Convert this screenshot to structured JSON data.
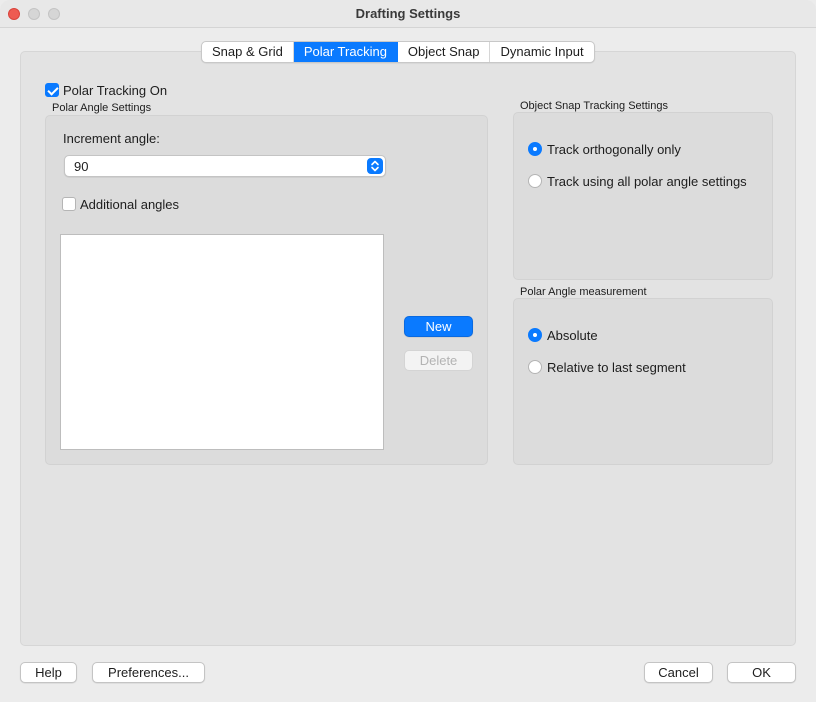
{
  "window": {
    "title": "Drafting Settings"
  },
  "tabs": [
    {
      "label": "Snap & Grid",
      "active": false
    },
    {
      "label": "Polar Tracking",
      "active": true
    },
    {
      "label": "Object Snap",
      "active": false
    },
    {
      "label": "Dynamic Input",
      "active": false
    }
  ],
  "polar": {
    "enable_label": "Polar Tracking On",
    "enabled": true,
    "group_title": "Polar Angle Settings",
    "increment_label": "Increment angle:",
    "increment_value": "90",
    "additional_label": "Additional angles",
    "additional_checked": false,
    "additional_list": [],
    "new_label": "New",
    "delete_label": "Delete"
  },
  "snap_tracking": {
    "group_title": "Object Snap Tracking Settings",
    "options": [
      {
        "label": "Track orthogonally only",
        "selected": true
      },
      {
        "label": "Track using all polar angle settings",
        "selected": false
      }
    ]
  },
  "measurement": {
    "group_title": "Polar Angle measurement",
    "options": [
      {
        "label": "Absolute",
        "selected": true
      },
      {
        "label": "Relative to last segment",
        "selected": false
      }
    ]
  },
  "footer": {
    "help_label": "Help",
    "preferences_label": "Preferences...",
    "cancel_label": "Cancel",
    "ok_label": "OK"
  },
  "colors": {
    "accent": "#0a7aff",
    "close_button": "#ee5b52"
  }
}
